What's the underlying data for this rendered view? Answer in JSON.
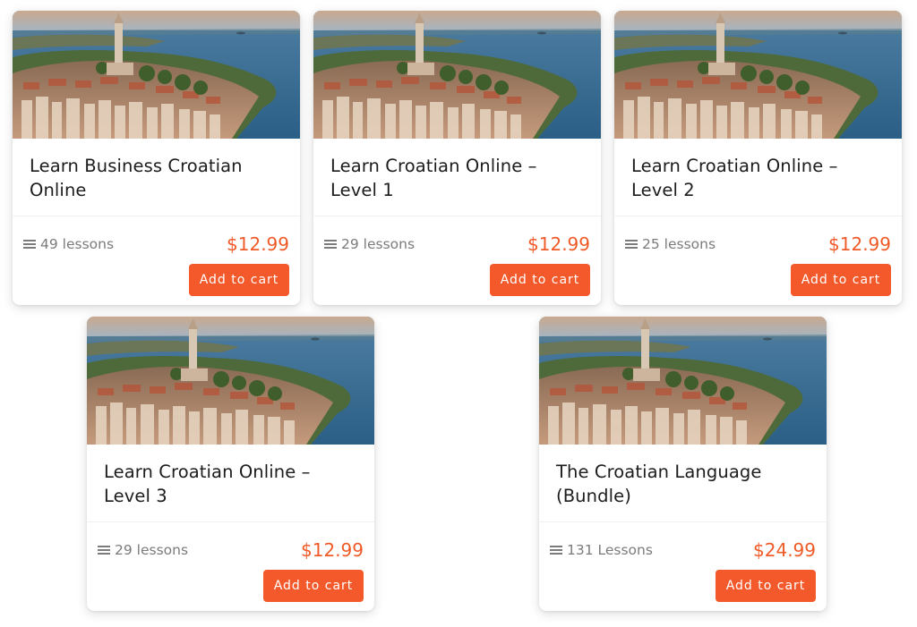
{
  "courses": [
    {
      "title": "Learn Business Croatian Online",
      "lessons": "49 lessons",
      "price": "$12.99",
      "button": "Add to cart"
    },
    {
      "title": "Learn Croatian Online – Level 1",
      "lessons": "29 lessons",
      "price": "$12.99",
      "button": "Add to cart"
    },
    {
      "title": "Learn Croatian Online – Level 2",
      "lessons": "25 lessons",
      "price": "$12.99",
      "button": "Add to cart"
    },
    {
      "title": "Learn Croatian Online – Level 3",
      "lessons": "29 lessons",
      "price": "$12.99",
      "button": "Add to cart"
    },
    {
      "title": "The Croatian Language (Bundle)",
      "lessons": "131 Lessons",
      "price": "$24.99",
      "button": "Add to cart"
    }
  ],
  "icons": {
    "lessons": "list-icon"
  },
  "colors": {
    "accent": "#f4592b",
    "price": "#f05a28",
    "muted_text": "#7b7b7b"
  }
}
